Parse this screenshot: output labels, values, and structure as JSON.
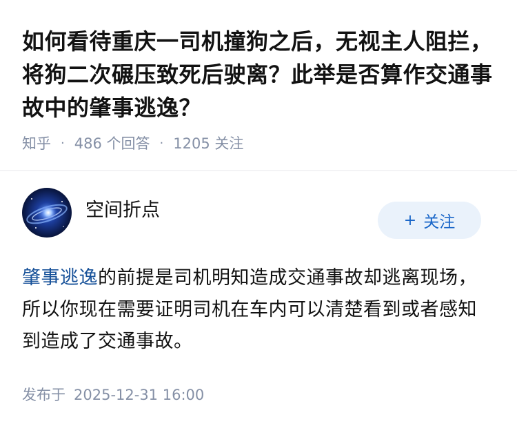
{
  "question": {
    "title": "如何看待重庆一司机撞狗之后，无视主人阻拦，将狗二次碾压致死后驶离？此举是否算作交通事故中的肇事逃逸？",
    "source": "知乎",
    "answers_count": "486 个回答",
    "follows_count": "1205 关注"
  },
  "answer": {
    "author_name": "空间折点",
    "follow_label": "关注",
    "follow_icon": "plus-icon",
    "content_link": "肇事逃逸",
    "content_rest": "的前提是司机明知造成交通事故却逃离现场，所以你现在需要证明司机在车内可以清楚看到或者感知到造成了交通事故。",
    "publish_label": "发布于",
    "publish_time": "2025-12-31 16:00"
  },
  "colors": {
    "link": "#175199",
    "follow_text": "#1966c8",
    "follow_bg": "#eaf2fb",
    "meta": "#8590a6"
  }
}
